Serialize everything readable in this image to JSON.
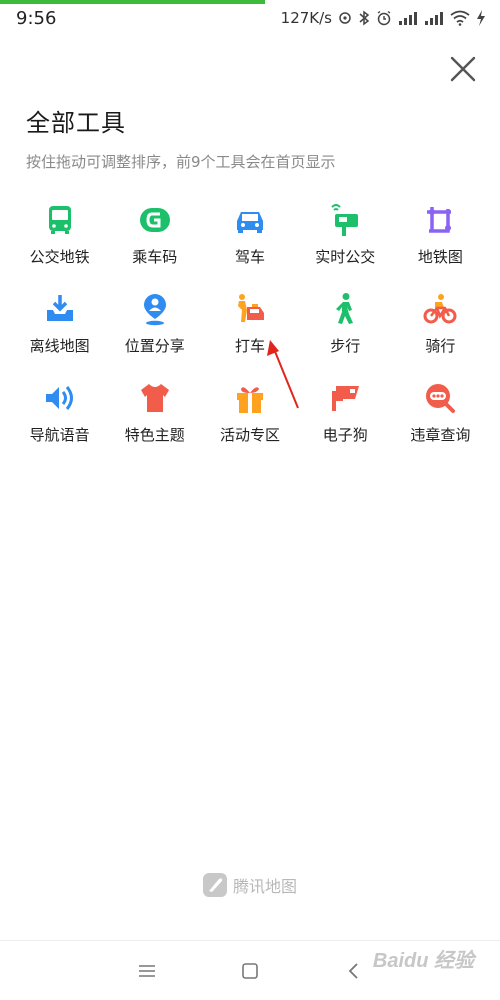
{
  "status": {
    "time": "9:56",
    "speed": "127K/s"
  },
  "page": {
    "title": "全部工具",
    "subtitle": "按住拖动可调整排序，前9个工具会在首页显示"
  },
  "tools": [
    {
      "label": "公交地铁",
      "icon": "bus-icon"
    },
    {
      "label": "乘车码",
      "icon": "ride-code-icon"
    },
    {
      "label": "驾车",
      "icon": "car-icon"
    },
    {
      "label": "实时公交",
      "icon": "realtime-bus-icon"
    },
    {
      "label": "地铁图",
      "icon": "subway-map-icon"
    },
    {
      "label": "离线地图",
      "icon": "offline-map-icon"
    },
    {
      "label": "位置分享",
      "icon": "location-share-icon"
    },
    {
      "label": "打车",
      "icon": "taxi-icon"
    },
    {
      "label": "步行",
      "icon": "walk-icon"
    },
    {
      "label": "骑行",
      "icon": "bike-icon"
    },
    {
      "label": "导航语音",
      "icon": "voice-icon"
    },
    {
      "label": "特色主题",
      "icon": "theme-icon"
    },
    {
      "label": "活动专区",
      "icon": "gift-icon"
    },
    {
      "label": "电子狗",
      "icon": "camera-icon"
    },
    {
      "label": "违章查询",
      "icon": "violation-icon"
    }
  ],
  "brand": {
    "name": "腾讯地图",
    "icon": "tencent-map-logo-icon"
  },
  "watermark": {
    "text": "Baidu 经验"
  },
  "colors": {
    "green": "#1cc06b",
    "blue": "#2f8cf0",
    "orange": "#ffa21f",
    "red": "#f25c4a",
    "purple": "#8a63f5"
  }
}
